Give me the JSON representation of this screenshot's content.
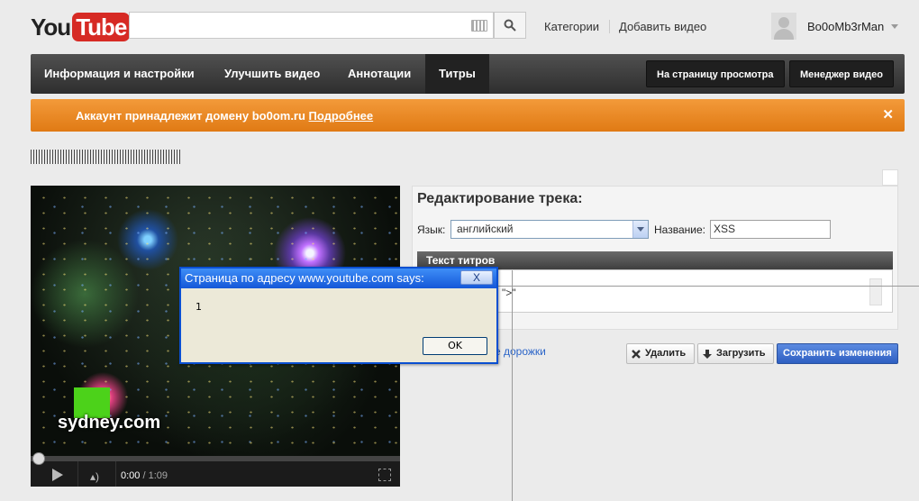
{
  "header": {
    "logo_you": "You",
    "logo_tube": "Tube",
    "search_placeholder": "",
    "categories": "Категории",
    "add_video": "Добавить видео",
    "username": "Bo0oMb3rMan"
  },
  "nav": {
    "tabs": [
      {
        "label": "Информация и настройки"
      },
      {
        "label": "Улучшить видео"
      },
      {
        "label": "Аннотации"
      },
      {
        "label": "Титры",
        "active": true
      }
    ],
    "watch_page": "На страницу просмотра",
    "video_manager": "Менеджер видео"
  },
  "banner": {
    "text": "Аккаунт принадлежит домену bo0om.ru ",
    "link": "Подробнее",
    "close": "✕"
  },
  "video": {
    "overlay_text": "sydney.com",
    "current_time": "0:00",
    "duration": " / 1:09",
    "progress": 0
  },
  "editor": {
    "title": "Редактирование трека:",
    "language_label": "Язык:",
    "language_value": "английский",
    "name_label": "Название:",
    "name_value": "XSS",
    "subtitles_header": "Текст титров",
    "subtitles_fragment": "\">\"",
    "tracks_link": "е дорожки",
    "delete": "Удалить",
    "upload": "Загрузить",
    "save": "Сохранить изменения"
  },
  "dialog": {
    "title": "Страница по адресу www.youtube.com says:",
    "close": "X",
    "message": "1",
    "ok": "OK"
  },
  "colors": {
    "banner": "#e8861f",
    "nav": "#3a3a3a",
    "save_button": "#3c6ed0",
    "youtube_red": "#d62a24"
  }
}
